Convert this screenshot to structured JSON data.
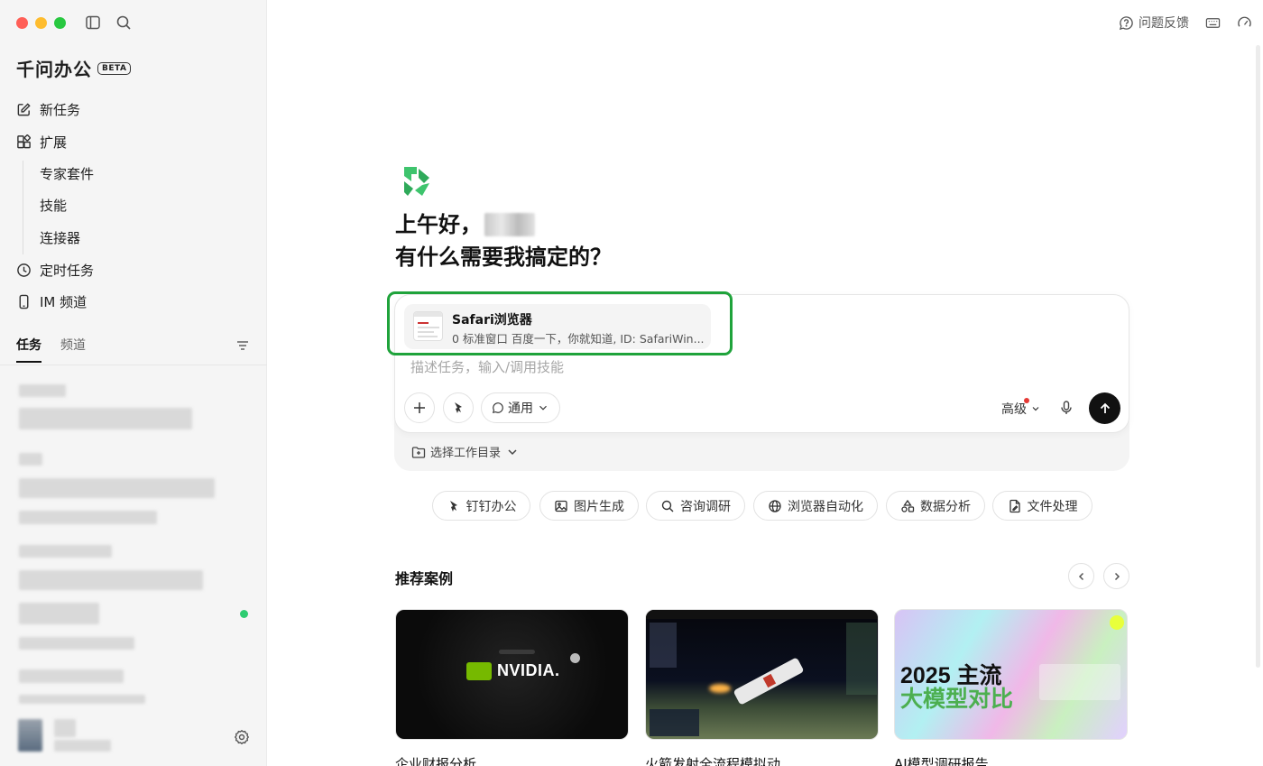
{
  "app": {
    "brand_name": "千问办公",
    "beta_label": "BETA"
  },
  "sidebar": {
    "nav": [
      {
        "label": "新任务",
        "icon": "edit-icon"
      },
      {
        "label": "扩展",
        "icon": "grid-icon"
      }
    ],
    "sub_items": [
      "专家套件",
      "技能",
      "连接器"
    ],
    "nav2": [
      {
        "label": "定时任务",
        "icon": "clock-icon"
      },
      {
        "label": "IM 频道",
        "icon": "phone-icon"
      }
    ],
    "tabs": [
      "任务",
      "频道"
    ]
  },
  "header": {
    "feedback_label": "问题反馈"
  },
  "main": {
    "greeting_line1": "上午好，",
    "greeting_line2": "有什么需要我搞定的？",
    "attachment": {
      "title": "Safari浏览器",
      "subtitle": "0 标准窗口 百度一下，你就知道, ID: SafariWin..."
    },
    "input_placeholder": "描述任务，输入/调用技能",
    "mode_label": "通用",
    "advanced_label": "高级",
    "workdir_label": "选择工作目录",
    "chips": [
      "钉钉办公",
      "图片生成",
      "咨询调研",
      "浏览器自动化",
      "数据分析",
      "文件处理"
    ],
    "recommend_title": "推荐案例",
    "cards": [
      {
        "label": "企业财报分析",
        "image_text": "NVIDIA."
      },
      {
        "label": "火箭发射全流程模拟动",
        "image_text": ""
      },
      {
        "label": "AI模型调研报告",
        "image_text_1": "2025 主流",
        "image_text_2": "大模型对比"
      }
    ]
  },
  "colors": {
    "accent_green": "#1fa33b",
    "logo_green": "#3ec46d",
    "send_button": "#111111"
  }
}
